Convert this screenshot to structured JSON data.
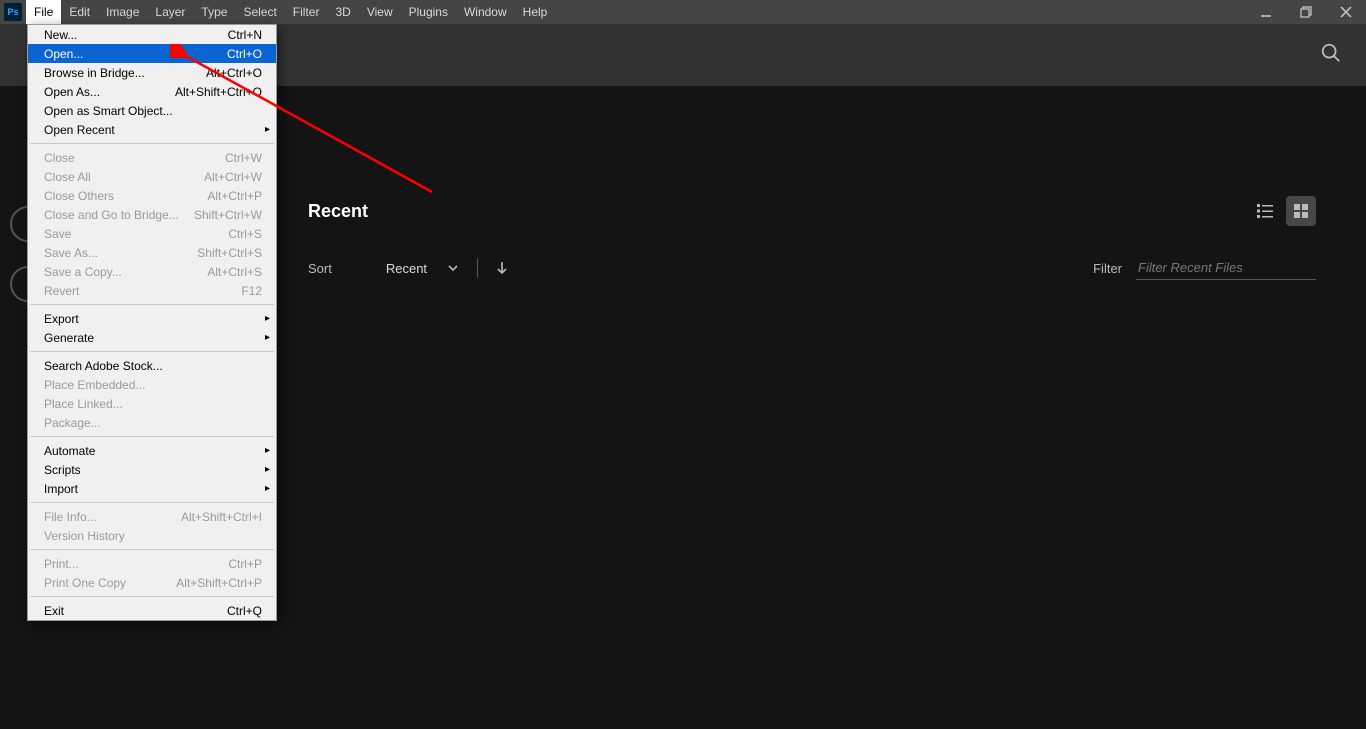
{
  "menubar": {
    "items": [
      "File",
      "Edit",
      "Image",
      "Layer",
      "Type",
      "Select",
      "Filter",
      "3D",
      "View",
      "Plugins",
      "Window",
      "Help"
    ],
    "active_index": 0
  },
  "file_menu": {
    "groups": [
      [
        {
          "label": "New...",
          "shortcut": "Ctrl+N",
          "enabled": true,
          "submenu": false,
          "highlight": false
        },
        {
          "label": "Open...",
          "shortcut": "Ctrl+O",
          "enabled": true,
          "submenu": false,
          "highlight": true
        },
        {
          "label": "Browse in Bridge...",
          "shortcut": "Alt+Ctrl+O",
          "enabled": true,
          "submenu": false,
          "highlight": false
        },
        {
          "label": "Open As...",
          "shortcut": "Alt+Shift+Ctrl+O",
          "enabled": true,
          "submenu": false,
          "highlight": false
        },
        {
          "label": "Open as Smart Object...",
          "shortcut": "",
          "enabled": true,
          "submenu": false,
          "highlight": false
        },
        {
          "label": "Open Recent",
          "shortcut": "",
          "enabled": true,
          "submenu": true,
          "highlight": false
        }
      ],
      [
        {
          "label": "Close",
          "shortcut": "Ctrl+W",
          "enabled": false,
          "submenu": false,
          "highlight": false
        },
        {
          "label": "Close All",
          "shortcut": "Alt+Ctrl+W",
          "enabled": false,
          "submenu": false,
          "highlight": false
        },
        {
          "label": "Close Others",
          "shortcut": "Alt+Ctrl+P",
          "enabled": false,
          "submenu": false,
          "highlight": false
        },
        {
          "label": "Close and Go to Bridge...",
          "shortcut": "Shift+Ctrl+W",
          "enabled": false,
          "submenu": false,
          "highlight": false
        },
        {
          "label": "Save",
          "shortcut": "Ctrl+S",
          "enabled": false,
          "submenu": false,
          "highlight": false
        },
        {
          "label": "Save As...",
          "shortcut": "Shift+Ctrl+S",
          "enabled": false,
          "submenu": false,
          "highlight": false
        },
        {
          "label": "Save a Copy...",
          "shortcut": "Alt+Ctrl+S",
          "enabled": false,
          "submenu": false,
          "highlight": false
        },
        {
          "label": "Revert",
          "shortcut": "F12",
          "enabled": false,
          "submenu": false,
          "highlight": false
        }
      ],
      [
        {
          "label": "Export",
          "shortcut": "",
          "enabled": true,
          "submenu": true,
          "highlight": false
        },
        {
          "label": "Generate",
          "shortcut": "",
          "enabled": true,
          "submenu": true,
          "highlight": false
        }
      ],
      [
        {
          "label": "Search Adobe Stock...",
          "shortcut": "",
          "enabled": true,
          "submenu": false,
          "highlight": false
        },
        {
          "label": "Place Embedded...",
          "shortcut": "",
          "enabled": false,
          "submenu": false,
          "highlight": false
        },
        {
          "label": "Place Linked...",
          "shortcut": "",
          "enabled": false,
          "submenu": false,
          "highlight": false
        },
        {
          "label": "Package...",
          "shortcut": "",
          "enabled": false,
          "submenu": false,
          "highlight": false
        }
      ],
      [
        {
          "label": "Automate",
          "shortcut": "",
          "enabled": true,
          "submenu": true,
          "highlight": false
        },
        {
          "label": "Scripts",
          "shortcut": "",
          "enabled": true,
          "submenu": true,
          "highlight": false
        },
        {
          "label": "Import",
          "shortcut": "",
          "enabled": true,
          "submenu": true,
          "highlight": false
        }
      ],
      [
        {
          "label": "File Info...",
          "shortcut": "Alt+Shift+Ctrl+I",
          "enabled": false,
          "submenu": false,
          "highlight": false
        },
        {
          "label": "Version History",
          "shortcut": "",
          "enabled": false,
          "submenu": false,
          "highlight": false
        }
      ],
      [
        {
          "label": "Print...",
          "shortcut": "Ctrl+P",
          "enabled": false,
          "submenu": false,
          "highlight": false
        },
        {
          "label": "Print One Copy",
          "shortcut": "Alt+Shift+Ctrl+P",
          "enabled": false,
          "submenu": false,
          "highlight": false
        }
      ],
      [
        {
          "label": "Exit",
          "shortcut": "Ctrl+Q",
          "enabled": true,
          "submenu": false,
          "highlight": false
        }
      ]
    ]
  },
  "home": {
    "recent_title": "Recent",
    "sort_label": "Sort",
    "sort_value": "Recent",
    "filter_label": "Filter",
    "filter_placeholder": "Filter Recent Files"
  },
  "ps_logo_text": "Ps"
}
